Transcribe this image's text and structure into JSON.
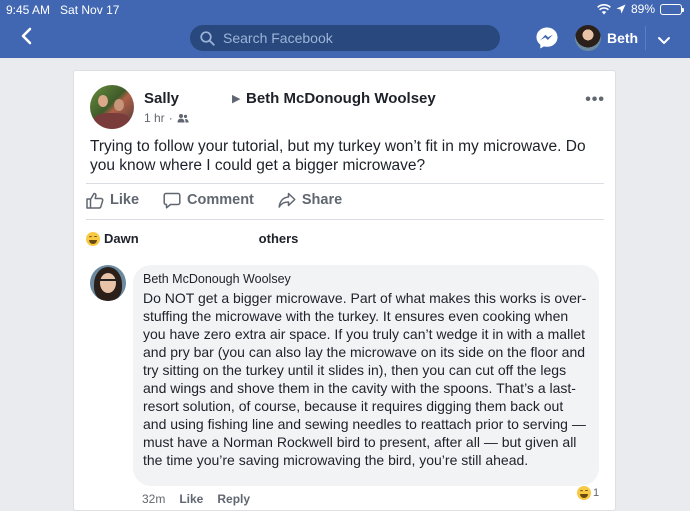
{
  "status_bar": {
    "time": "9:45 AM",
    "date": "Sat Nov 17",
    "battery": "89%",
    "battery_level": 0.89
  },
  "nav": {
    "search_placeholder": "Search Facebook",
    "user_name": "Beth"
  },
  "post": {
    "author": "Sally",
    "target": "Beth McDonough Woolsey",
    "time": "1 hr",
    "audience_icon": "friends-icon",
    "text": "Trying to follow your tutorial, but my turkey won’t fit in my microwave.  Do you know where I could get a bigger microwave?",
    "actions": {
      "like": "Like",
      "comment": "Comment",
      "share": "Share"
    },
    "reactions": {
      "first": "Dawn",
      "others": "others"
    }
  },
  "comment": {
    "author": "Beth McDonough Woolsey",
    "text": "Do NOT get a bigger microwave. Part of what makes this works is over-stuffing the microwave with the turkey. It ensures even cooking when you have zero extra air space. If you truly can’t wedge it in with a mallet and pry bar (you can also lay the microwave on its side on the floor and try sitting on the turkey until it slides in), then you can cut off the legs and wings and shove them in the cavity with the spoons. That’s a last-resort solution, of course, because it requires digging them back out and using fishing line and sewing needles to reattach prior to serving — must have a Norman Rockwell bird to present, after all — but given all the time you’re saving microwaving the bird, you’re still ahead.",
    "time": "32m",
    "like": "Like",
    "reply": "Reply",
    "reaction_count": "1"
  }
}
